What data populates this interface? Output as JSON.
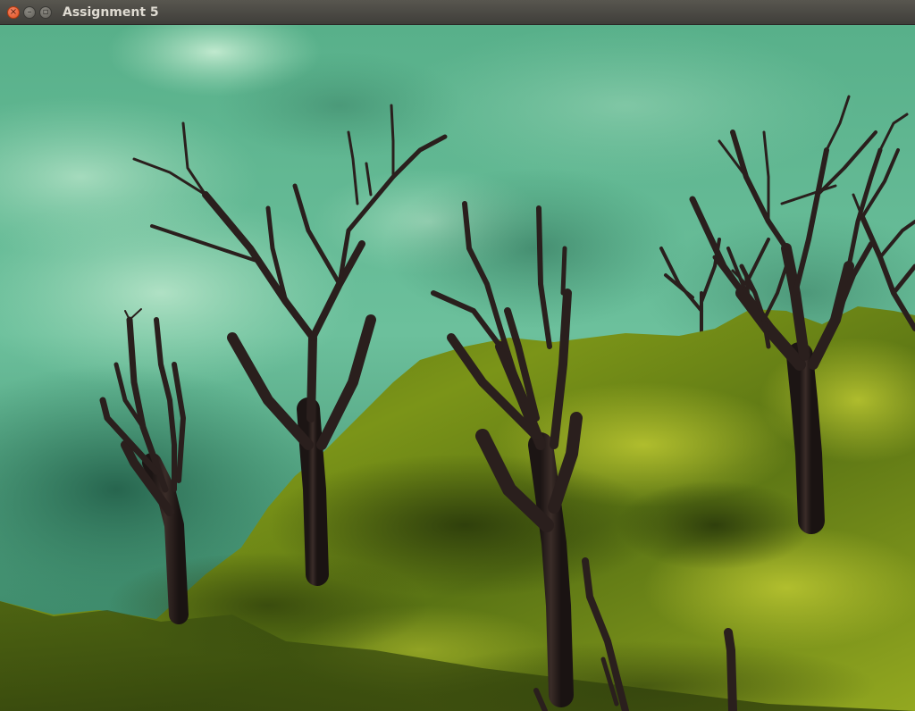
{
  "window": {
    "title": "Assignment 5",
    "controls": {
      "close_icon": "close-icon",
      "minimize_icon": "minimize-icon",
      "maximize_icon": "maximize-icon"
    }
  },
  "scene": {
    "type": "3D terrain render",
    "sky_color": "#5fb594",
    "sky_dark_color": "#2f7a5c",
    "grass_color": "#5f7a18",
    "grass_highlight": "#a9b92c",
    "bark_color": "#2a1f1d",
    "tree_count": 8
  }
}
